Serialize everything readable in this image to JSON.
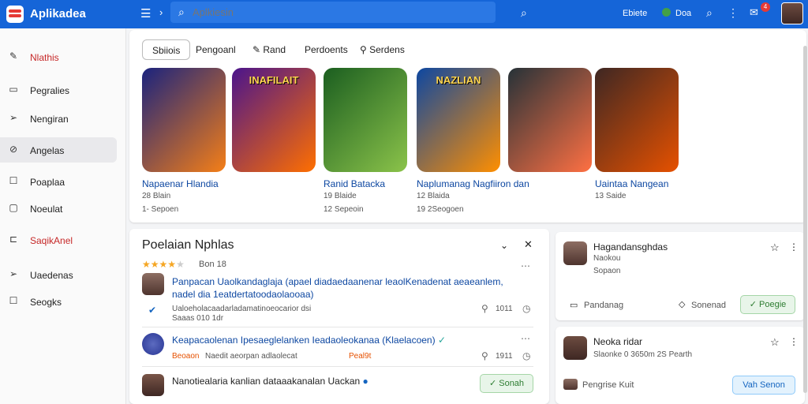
{
  "app": {
    "name": "Aplikadea",
    "logo": "app-logo"
  },
  "topbar": {
    "search_placeholder": "Aplkiesin",
    "status_text": "Ebiete",
    "user_text": "Doa",
    "notif_count": "4"
  },
  "sidebar": {
    "items": [
      {
        "label": "Nlathis",
        "icon": "edit-icon",
        "red": true
      },
      {
        "label": "Pegralies",
        "icon": "document-icon"
      },
      {
        "label": "Nengiran",
        "icon": "send-icon"
      },
      {
        "label": "Angelas",
        "icon": "link-icon",
        "active": true
      },
      {
        "label": "Poaplaa",
        "icon": "square-icon"
      },
      {
        "label": "Noeulat",
        "icon": "message-icon"
      },
      {
        "label": "SaqikAnel",
        "icon": "tag-icon",
        "red": true
      },
      {
        "label": "Uaedenas",
        "icon": "send-icon"
      },
      {
        "label": "Seogks",
        "icon": "square-icon"
      }
    ]
  },
  "filters": [
    {
      "label": "Sbiiois",
      "selected": true
    },
    {
      "label": "Pengoanl"
    },
    {
      "label": "Rand",
      "icon": "edit-icon"
    },
    {
      "label": "Perdoents"
    },
    {
      "label": "Serdens",
      "icon": "pin-icon"
    }
  ],
  "games": [
    {
      "title": "Napaenar Hlandia",
      "sub1": "28 Blain",
      "sub2": "1- Sepoen",
      "art_text": "",
      "colors": [
        "#1a237e",
        "#f57f17"
      ]
    },
    {
      "title": "",
      "sub1": "",
      "sub2": "",
      "art_text": "INAFILAIT",
      "colors": [
        "#4a148c",
        "#ff6f00"
      ]
    },
    {
      "title": "Ranid Batacka",
      "sub1": "19 Blaide",
      "sub2": "12 Sepeoin",
      "art_text": "",
      "colors": [
        "#1b5e20",
        "#8bc34a"
      ]
    },
    {
      "title": "Naplumanag Nagfiiron dan",
      "sub1": "12 Blaida",
      "sub2": "19 2Seogoen",
      "art_text": "NAZLIAN",
      "colors": [
        "#0d47a1",
        "#ff8f00"
      ]
    },
    {
      "title": "",
      "sub1": "",
      "sub2": "",
      "art_text": "",
      "colors": [
        "#263238",
        "#ff7043"
      ]
    },
    {
      "title": "Uaintaa Nangean",
      "sub1": "13 Saide",
      "sub2": "",
      "art_text": "",
      "colors": [
        "#3e2723",
        "#e65100"
      ]
    }
  ],
  "post": {
    "title": "Poelaian  Nphlas",
    "rating": 4,
    "rating_text": "Bon  18",
    "item1": {
      "text1": "Panpacan Uaolkandaglaja (apael diadaedaanenar leaolKenadenat aeaeanlem,",
      "text2": "nadel dia 1eatdertatoodaolaooaa)",
      "meta": "Ualoeholacaadarladamatinoeocarior dsi",
      "meta2": "Saaas 010 1dr",
      "count": "1011"
    },
    "item2": {
      "text": "Keapacaolenan Ipesaeglelanken Ieadaoleokanaa (Klaelacoen)",
      "meta_tag": "Beoaon",
      "meta": "Naedit aeorpan adlaolecat",
      "meta_hl": "Peal9t",
      "count": "1911"
    },
    "item3": {
      "text": "Nanotiealaria kanlian dataaakanalan Uackan",
      "button": "Sonah"
    }
  },
  "side1": {
    "name": "Hagandansghdas",
    "line1": "Naokou",
    "line2": "Sopaon",
    "action1": "Pandanag",
    "action2": "Sonenad",
    "button": "Poegie"
  },
  "side2": {
    "name": "Neoka ridar",
    "line1": "Slaonke 0 3650m 2S  Pearth",
    "action": "Pengrise Kuit",
    "button": "Vah Senon"
  }
}
